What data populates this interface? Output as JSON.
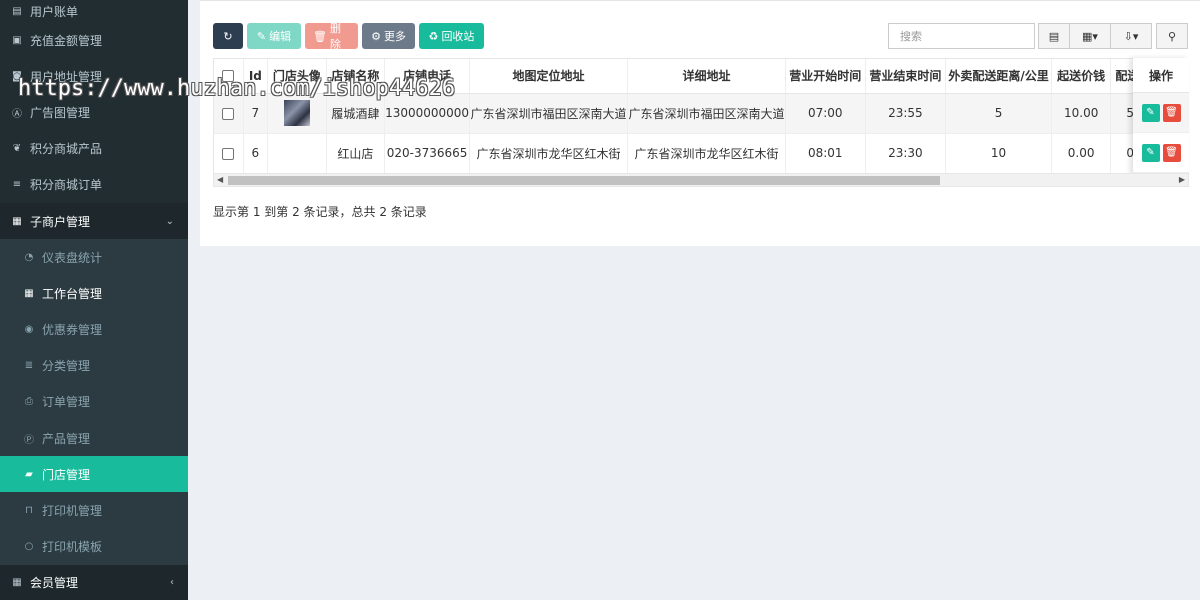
{
  "watermark": "https://www.huzhan.com/ishop44626",
  "sidebar": {
    "items": [
      {
        "label": "用户账单",
        "icon": "list-alt-icon",
        "kind": "top"
      },
      {
        "label": "充值金额管理",
        "icon": "money-icon",
        "kind": "top"
      },
      {
        "label": "用户地址管理",
        "icon": "address-icon",
        "kind": "top"
      },
      {
        "label": "广告图管理",
        "icon": "ad-icon",
        "kind": "top"
      },
      {
        "label": "积分商城产品",
        "icon": "gift-icon",
        "kind": "top"
      },
      {
        "label": "积分商城订单",
        "icon": "bars-icon",
        "kind": "top"
      },
      {
        "label": "子商户管理",
        "icon": "table-icon",
        "kind": "group"
      },
      {
        "label": "仪表盘统计",
        "icon": "dashboard-icon",
        "kind": "sub"
      },
      {
        "label": "工作台管理",
        "icon": "table-icon",
        "kind": "sub-bright"
      },
      {
        "label": "优惠券管理",
        "icon": "coupon-icon",
        "kind": "sub"
      },
      {
        "label": "分类管理",
        "icon": "list-icon",
        "kind": "sub"
      },
      {
        "label": "订单管理",
        "icon": "print-icon",
        "kind": "sub"
      },
      {
        "label": "产品管理",
        "icon": "product-icon",
        "kind": "sub"
      },
      {
        "label": "门店管理",
        "icon": "shop-icon",
        "kind": "active"
      },
      {
        "label": "打印机管理",
        "icon": "printer-icon",
        "kind": "sub"
      },
      {
        "label": "打印机模板",
        "icon": "circle-icon",
        "kind": "sub"
      },
      {
        "label": "会员管理",
        "icon": "table-icon",
        "kind": "bottom"
      }
    ]
  },
  "toolbar": {
    "refresh_icon": "refresh-icon",
    "edit_label": "编辑",
    "delete_label": "删除",
    "more_label": "更多",
    "recycle_label": "回收站",
    "search_placeholder": "搜索"
  },
  "table": {
    "columns": [
      "Id",
      "门店头像",
      "店铺名称",
      "店铺电话",
      "地图定位地址",
      "详细地址",
      "营业开始时间",
      "营业结束时间",
      "外卖配送距离/公里",
      "起送价钱",
      "配送"
    ],
    "operations_label": "操作",
    "rows": [
      {
        "id": "7",
        "name": "履城酒肆",
        "phone": "13000000000",
        "map_address": "广东省深圳市福田区深南大道",
        "detail_address": "广东省深圳市福田区深南大道",
        "open": "07:00",
        "close": "23:55",
        "distance": "5",
        "min_price": "10.00",
        "delivery": "5"
      },
      {
        "id": "6",
        "name": "红山店",
        "phone": "020-3736665",
        "map_address": "广东省深圳市龙华区红木街",
        "detail_address": "广东省深圳市龙华区红木街",
        "open": "08:01",
        "close": "23:30",
        "distance": "10",
        "min_price": "0.00",
        "delivery": "0"
      }
    ]
  },
  "pagination": {
    "info": "显示第 1 到第 2 条记录，总共 2 条记录"
  },
  "colors": {
    "sidebar_bg": "#222d32",
    "active": "#18bc9c",
    "danger": "#e74c3c"
  }
}
